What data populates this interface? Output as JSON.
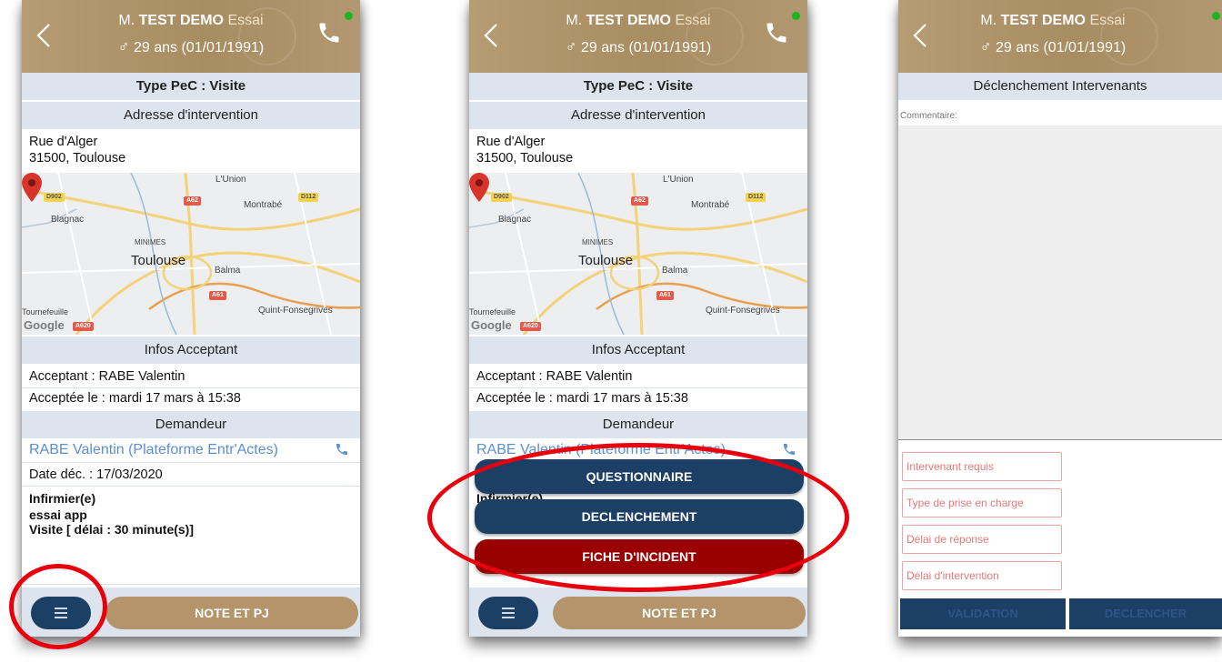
{
  "patient": {
    "title": "M.",
    "last_name": "TEST DEMO",
    "first_name": "Essai",
    "age_text": "29 ans (01/01/1991)",
    "gender_symbol": "♂"
  },
  "screen1": {
    "type_pec": "Type PeC : Visite",
    "address_header": "Adresse d'intervention",
    "address_line1": "Rue d'Alger",
    "address_line2": "31500, Toulouse",
    "map": {
      "city": "Toulouse",
      "labels": [
        "L'Union",
        "Montrabé",
        "Blagnac",
        "MINIMES",
        "Balma",
        "Quint-Fonsegrives",
        "Tournefeuille"
      ],
      "roads": [
        "D902",
        "A62",
        "D112",
        "A61",
        "A620"
      ],
      "attribution": "Google"
    },
    "acceptant_header": "Infos Acceptant",
    "acceptant_line": "Acceptant : RABE Valentin",
    "accepted_line": "Acceptée le : mardi 17 mars à 15:38",
    "demandeur_header": "Demandeur",
    "demandeur_name": "RABE Valentin (Plateforme Entr'Actes)",
    "date_line": "Date déc. : 17/03/2020",
    "role": "Infirmier(e)",
    "app": "essai app",
    "visit": "Visite  [ délai : 30 minute(s)]",
    "note_button": "NOTE ET PJ"
  },
  "screen2": {
    "menu_actions": [
      "QUESTIONNAIRE",
      "DECLENCHEMENT",
      "FICHE D'INCIDENT"
    ],
    "note_button": "NOTE ET PJ"
  },
  "screen3": {
    "section_title": "Déclenchement Intervenants",
    "comment_label": "Commentaire:",
    "fields": [
      "Intervenant requis",
      "Type de prise en charge",
      "Délai de réponse",
      "Délai d'intervention"
    ],
    "validation_button": "VALIDATION",
    "declencher_button": "DECLENCHER"
  },
  "colors": {
    "header_gold": "#a88c62",
    "navy": "#1c3f66",
    "incident_red": "#990000",
    "annotation_red": "#e8000c",
    "section_bg": "#dde4ee",
    "link_blue": "#5b8fd3",
    "status_green": "#1db51f"
  }
}
